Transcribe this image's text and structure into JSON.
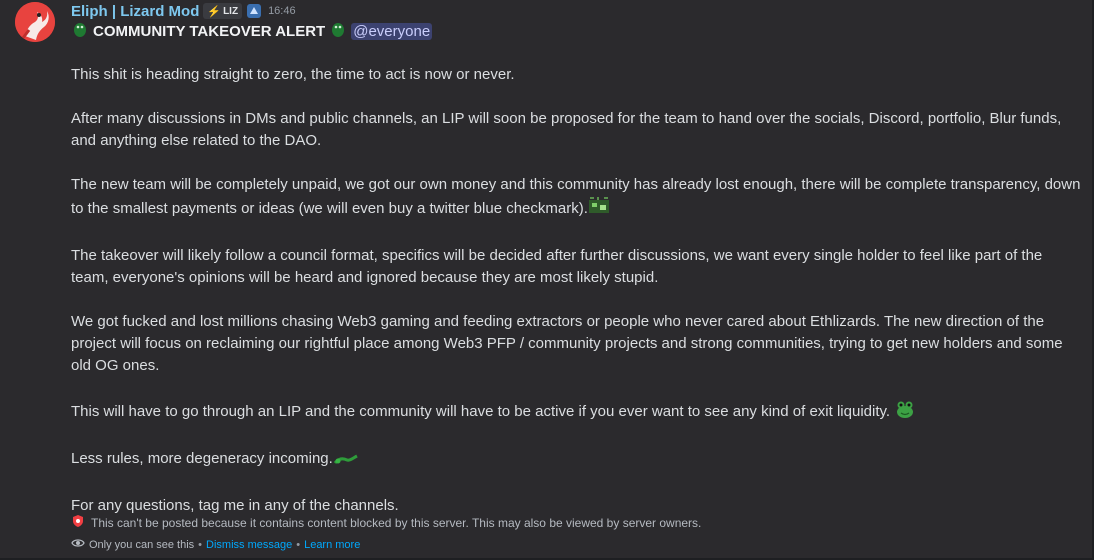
{
  "author": {
    "name": "Eliph | Lizard Mod",
    "tag": "LIZ",
    "timestamp": "16:46"
  },
  "message": {
    "headline": "COMMUNITY TAKEOVER ALERT",
    "mention": "@everyone",
    "paragraphs": [
      "This shit is heading straight to zero, the time to act is now or never.",
      "After many discussions in DMs and public channels, an LIP will soon be proposed for the team to hand over the socials, Discord, portfolio, Blur funds, and anything else related to the DAO.",
      "The new team will be completely unpaid, we got our own money and this community has already lost enough, there will be complete transparency, down to the smallest payments or ideas (we will even buy a twitter blue checkmark).",
      "The takeover will likely follow a council format, specifics will be decided after further discussions, we want every single holder to feel like part of the team, everyone's opinions will be heard and ignored because they are most likely stupid.",
      "We got fucked and lost millions chasing Web3 gaming and feeding extractors or people who never cared about Ethlizards. The new direction of the project will focus on reclaiming our rightful place among Web3 PFP / community projects and strong communities, trying to get new holders and some old  OG ones.",
      "This will have to go through an LIP and the community will have to be active if you ever want to see any kind of exit liquidity.",
      "Less rules, more degeneracy incoming.",
      "For any questions, tag me in any of the channels."
    ]
  },
  "notices": {
    "blocked": "This can't be posted because it contains content blocked by this server. This may also be viewed by server owners.",
    "only_you": "Only you can see this",
    "separator": "•",
    "dismiss": "Dismiss message",
    "learn_more": "Learn more"
  },
  "colors": {
    "background": "#2b2a2d",
    "username": "#7ec8ef",
    "link": "#00a8fc",
    "mention_bg": "#3c4270"
  },
  "icons": [
    "lizard-avatar-icon",
    "bolt-icon",
    "role-icon",
    "lizard-emoji-icon",
    "circuit-emoji-icon",
    "frog-emoji-icon",
    "lizard-run-emoji-icon",
    "shield-alert-icon",
    "eye-icon"
  ]
}
